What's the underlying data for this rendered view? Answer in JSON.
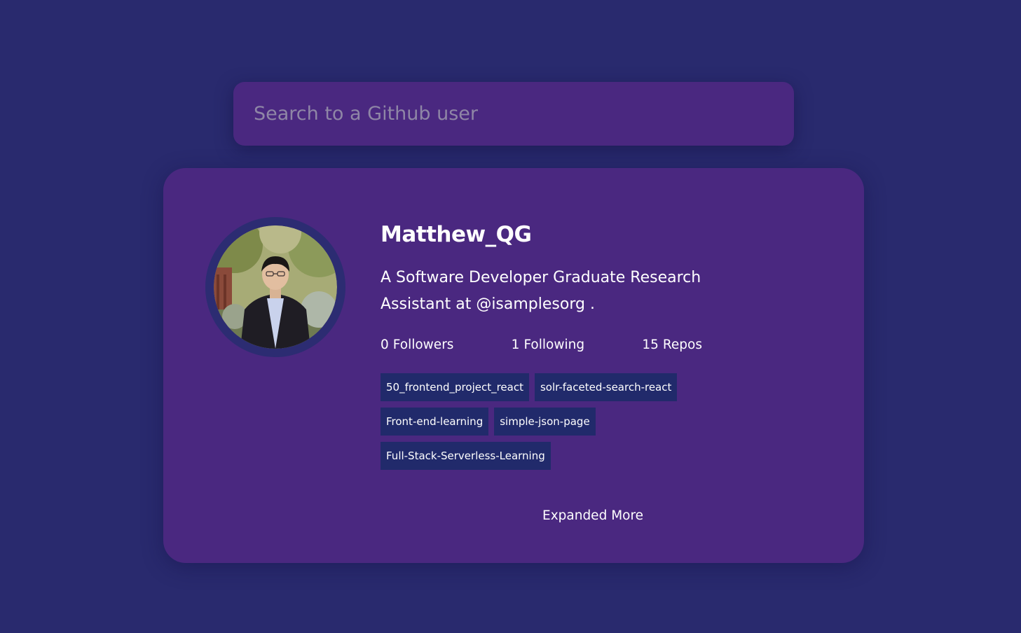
{
  "search": {
    "placeholder": "Search to a Github user",
    "value": ""
  },
  "profile": {
    "name": "Matthew_QG",
    "bio": "A Software Developer Graduate Research Assistant at @isamplesorg .",
    "avatar_icon": "user-photo",
    "stats": {
      "followers_value": "0",
      "followers_label": "Followers",
      "following_value": "1",
      "following_label": "Following",
      "repos_value": "15",
      "repos_label": "Repos"
    },
    "repos": [
      "50_frontend_project_react",
      "solr-faceted-search-react",
      "Front-end-learning",
      "simple-json-page",
      "Full-Stack-Serverless-Learning"
    ],
    "expand_label": "Expanded More"
  },
  "colors": {
    "background": "#292a6e",
    "card": "#4a2880",
    "repo_chip": "#212a6b",
    "avatar_ring": "#2c2c72",
    "placeholder": "#8f86a6"
  }
}
